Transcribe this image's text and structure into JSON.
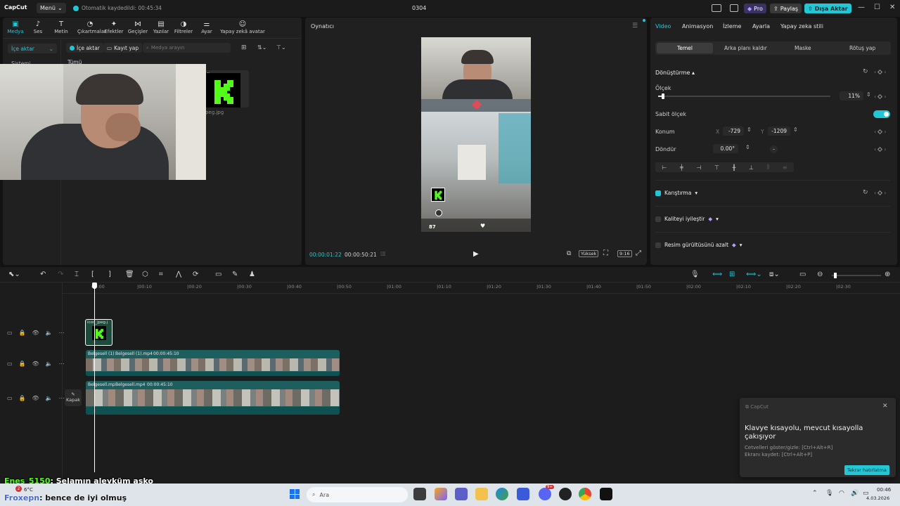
{
  "app": {
    "logo": "CapCut",
    "menu_label": "Menü",
    "autosave": "Otomatik kaydedildi: 00:45:34",
    "project_name": "0304",
    "pro_label": "Pro",
    "share_label": "Paylaş",
    "export_label": "Dışa Aktar"
  },
  "media_panel": {
    "tabs": [
      {
        "label": "Medya",
        "icon": "media-icon",
        "glyph": "▣"
      },
      {
        "label": "Ses",
        "icon": "audio-icon",
        "glyph": "♪"
      },
      {
        "label": "Metin",
        "icon": "text-icon",
        "glyph": "T"
      },
      {
        "label": "Çıkartmalar",
        "icon": "sticker-icon",
        "glyph": "◔"
      },
      {
        "label": "Efektler",
        "icon": "effects-icon",
        "glyph": "✦"
      },
      {
        "label": "Geçişler",
        "icon": "transition-icon",
        "glyph": "⋈"
      },
      {
        "label": "Yazılar",
        "icon": "captions-icon",
        "glyph": "▤"
      },
      {
        "label": "Filtreler",
        "icon": "filter-icon",
        "glyph": "◑"
      },
      {
        "label": "Ayar",
        "icon": "adjust-icon",
        "glyph": "⚌"
      },
      {
        "label": "Yapay zekâ avatar",
        "icon": "ai-avatar-icon",
        "glyph": "☺"
      }
    ],
    "import_dropdown": "İçe aktar",
    "import_button": "İçe aktar",
    "record_button": "Kayıt yap",
    "search_placeholder": "Medya arayın",
    "sidebar_item": "Sistemi",
    "all_label": "Tümü",
    "thumb_caption": "jpeg.jpg",
    "thumb_badge": "ndi"
  },
  "player": {
    "title": "Oynatıcı",
    "current_time": "00:00:01:22",
    "total_time": "00:00:50:21",
    "quality": "Yüksek",
    "ratio": "9:16",
    "hud_number": "87"
  },
  "inspector": {
    "tabs": [
      "Video",
      "Animasyon",
      "İzleme",
      "Ayarla",
      "Yapay zeka stili"
    ],
    "subtabs": [
      "Temel",
      "Arka planı kaldır",
      "Maske",
      "Rötuş yap"
    ],
    "transform_title": "Dönüştürme",
    "scale_label": "Ölçek",
    "scale_value": "11%",
    "scale_fraction": 0.02,
    "uniform_scale_label": "Sabit ölçek",
    "position_label": "Konum",
    "x_label": "X",
    "x_value": "-729",
    "y_label": "Y",
    "y_value": "-1209",
    "rotate_label": "Döndür",
    "rotate_value": "0.00°",
    "blend_label": "Karıştırma",
    "quality_label": "Kaliteyi iyileştir",
    "denoise_label": "Resim gürültüsünü azalt",
    "accent": "#22c7d6"
  },
  "timeline": {
    "ruler": [
      "00:00",
      "|00:10",
      "|00:20",
      "|00:30",
      "|00:40",
      "|00:50",
      "|01:00",
      "|01:10",
      "|01:20",
      "|01:30",
      "|01:40",
      "|01:50",
      "|02:00",
      "|02:10",
      "|02:20",
      "|02:30"
    ],
    "clip_image_label": "icon_jpeg.j",
    "clip1_name_a": "Belgesell (1)",
    "clip1_name_b": "Belgesell (1).mp4",
    "clip1_duration": "00:00:45:10",
    "clip2_name_a": "Belgesell.mp",
    "clip2_name_b": "Belgesell.mp4",
    "clip2_duration": "00:00:45:10",
    "cover_label": "Kapak"
  },
  "toast": {
    "app_name": "CapCut",
    "title": "Klavye kısayolu, mevcut kısayolla çakışıyor",
    "line1": "Cetvelleri göster/gizle: [Ctrl+Alt+R]",
    "line2": "Ekranı kaydet: [Ctrl+Alt+P]",
    "dismiss_button": "Tekrar hatırlatma"
  },
  "chat": {
    "user1": "Enes_5150",
    "msg1": ": Selamın aleyküm asko",
    "user2": "Froxepn",
    "msg2": ": bence de iyi olmuş"
  },
  "taskbar": {
    "weather_temp": "6°C",
    "weather_badge": "2",
    "search_placeholder": "Ara",
    "discord_badge": "9+",
    "clock_time": "00:46",
    "clock_date": "4.03.2026"
  }
}
